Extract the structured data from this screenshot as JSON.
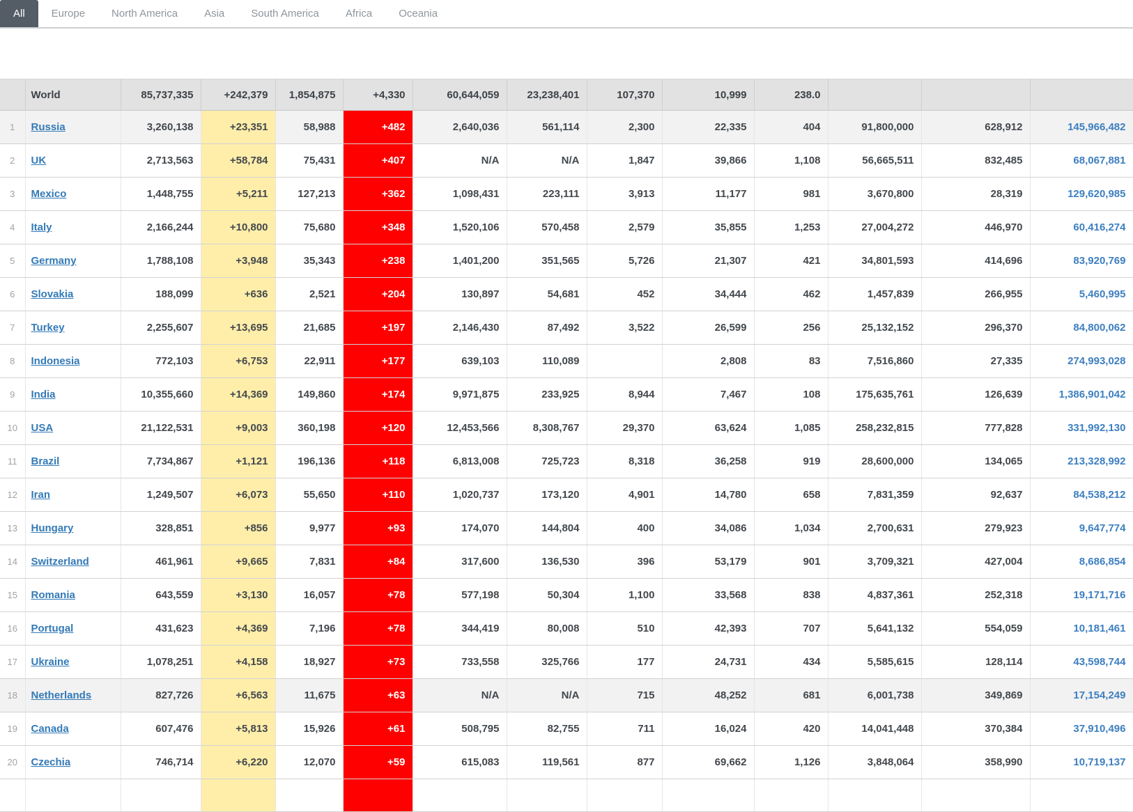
{
  "tabs": {
    "items": [
      {
        "label": "All",
        "active": true
      },
      {
        "label": "Europe",
        "active": false
      },
      {
        "label": "North America",
        "active": false
      },
      {
        "label": "Asia",
        "active": false
      },
      {
        "label": "South America",
        "active": false
      },
      {
        "label": "Africa",
        "active": false
      },
      {
        "label": "Oceania",
        "active": false
      }
    ]
  },
  "colors": {
    "active_tab_bg": "#545d66",
    "new_cases_bg": "#ffeeaa",
    "new_deaths_bg": "#ff0000",
    "link_blue": "#337ab7",
    "world_row_bg": "#e2e2e2",
    "shaded_row_bg": "#f2f2f2"
  },
  "table": {
    "column_keys": [
      "total_cases",
      "new_cases",
      "total_deaths",
      "new_deaths",
      "total_recovered",
      "active_cases",
      "serious_critical",
      "cases_per_1m",
      "deaths_per_1m",
      "total_tests",
      "tests_per_1m",
      "population"
    ],
    "world_row": {
      "label": "World",
      "values": {
        "total_cases": "85,737,335",
        "new_cases": "+242,379",
        "total_deaths": "1,854,875",
        "new_deaths": "+4,330",
        "total_recovered": "60,644,059",
        "active_cases": "23,238,401",
        "serious_critical": "107,370",
        "cases_per_1m": "10,999",
        "deaths_per_1m": "238.0",
        "total_tests": "",
        "tests_per_1m": "",
        "population": ""
      }
    },
    "rows": [
      {
        "rank": "1",
        "country": "Russia",
        "shaded": true,
        "values": {
          "total_cases": "3,260,138",
          "new_cases": "+23,351",
          "total_deaths": "58,988",
          "new_deaths": "+482",
          "total_recovered": "2,640,036",
          "active_cases": "561,114",
          "serious_critical": "2,300",
          "cases_per_1m": "22,335",
          "deaths_per_1m": "404",
          "total_tests": "91,800,000",
          "tests_per_1m": "628,912",
          "population": "145,966,482"
        }
      },
      {
        "rank": "2",
        "country": "UK",
        "shaded": false,
        "values": {
          "total_cases": "2,713,563",
          "new_cases": "+58,784",
          "total_deaths": "75,431",
          "new_deaths": "+407",
          "total_recovered": "N/A",
          "active_cases": "N/A",
          "serious_critical": "1,847",
          "cases_per_1m": "39,866",
          "deaths_per_1m": "1,108",
          "total_tests": "56,665,511",
          "tests_per_1m": "832,485",
          "population": "68,067,881"
        }
      },
      {
        "rank": "3",
        "country": "Mexico",
        "shaded": false,
        "values": {
          "total_cases": "1,448,755",
          "new_cases": "+5,211",
          "total_deaths": "127,213",
          "new_deaths": "+362",
          "total_recovered": "1,098,431",
          "active_cases": "223,111",
          "serious_critical": "3,913",
          "cases_per_1m": "11,177",
          "deaths_per_1m": "981",
          "total_tests": "3,670,800",
          "tests_per_1m": "28,319",
          "population": "129,620,985"
        }
      },
      {
        "rank": "4",
        "country": "Italy",
        "shaded": false,
        "values": {
          "total_cases": "2,166,244",
          "new_cases": "+10,800",
          "total_deaths": "75,680",
          "new_deaths": "+348",
          "total_recovered": "1,520,106",
          "active_cases": "570,458",
          "serious_critical": "2,579",
          "cases_per_1m": "35,855",
          "deaths_per_1m": "1,253",
          "total_tests": "27,004,272",
          "tests_per_1m": "446,970",
          "population": "60,416,274"
        }
      },
      {
        "rank": "5",
        "country": "Germany",
        "shaded": false,
        "values": {
          "total_cases": "1,788,108",
          "new_cases": "+3,948",
          "total_deaths": "35,343",
          "new_deaths": "+238",
          "total_recovered": "1,401,200",
          "active_cases": "351,565",
          "serious_critical": "5,726",
          "cases_per_1m": "21,307",
          "deaths_per_1m": "421",
          "total_tests": "34,801,593",
          "tests_per_1m": "414,696",
          "population": "83,920,769"
        }
      },
      {
        "rank": "6",
        "country": "Slovakia",
        "shaded": false,
        "values": {
          "total_cases": "188,099",
          "new_cases": "+636",
          "total_deaths": "2,521",
          "new_deaths": "+204",
          "total_recovered": "130,897",
          "active_cases": "54,681",
          "serious_critical": "452",
          "cases_per_1m": "34,444",
          "deaths_per_1m": "462",
          "total_tests": "1,457,839",
          "tests_per_1m": "266,955",
          "population": "5,460,995"
        }
      },
      {
        "rank": "7",
        "country": "Turkey",
        "shaded": false,
        "values": {
          "total_cases": "2,255,607",
          "new_cases": "+13,695",
          "total_deaths": "21,685",
          "new_deaths": "+197",
          "total_recovered": "2,146,430",
          "active_cases": "87,492",
          "serious_critical": "3,522",
          "cases_per_1m": "26,599",
          "deaths_per_1m": "256",
          "total_tests": "25,132,152",
          "tests_per_1m": "296,370",
          "population": "84,800,062"
        }
      },
      {
        "rank": "8",
        "country": "Indonesia",
        "shaded": false,
        "values": {
          "total_cases": "772,103",
          "new_cases": "+6,753",
          "total_deaths": "22,911",
          "new_deaths": "+177",
          "total_recovered": "639,103",
          "active_cases": "110,089",
          "serious_critical": "",
          "cases_per_1m": "2,808",
          "deaths_per_1m": "83",
          "total_tests": "7,516,860",
          "tests_per_1m": "27,335",
          "population": "274,993,028"
        }
      },
      {
        "rank": "9",
        "country": "India",
        "shaded": false,
        "values": {
          "total_cases": "10,355,660",
          "new_cases": "+14,369",
          "total_deaths": "149,860",
          "new_deaths": "+174",
          "total_recovered": "9,971,875",
          "active_cases": "233,925",
          "serious_critical": "8,944",
          "cases_per_1m": "7,467",
          "deaths_per_1m": "108",
          "total_tests": "175,635,761",
          "tests_per_1m": "126,639",
          "population": "1,386,901,042"
        }
      },
      {
        "rank": "10",
        "country": "USA",
        "shaded": false,
        "values": {
          "total_cases": "21,122,531",
          "new_cases": "+9,003",
          "total_deaths": "360,198",
          "new_deaths": "+120",
          "total_recovered": "12,453,566",
          "active_cases": "8,308,767",
          "serious_critical": "29,370",
          "cases_per_1m": "63,624",
          "deaths_per_1m": "1,085",
          "total_tests": "258,232,815",
          "tests_per_1m": "777,828",
          "population": "331,992,130"
        }
      },
      {
        "rank": "11",
        "country": "Brazil",
        "shaded": false,
        "values": {
          "total_cases": "7,734,867",
          "new_cases": "+1,121",
          "total_deaths": "196,136",
          "new_deaths": "+118",
          "total_recovered": "6,813,008",
          "active_cases": "725,723",
          "serious_critical": "8,318",
          "cases_per_1m": "36,258",
          "deaths_per_1m": "919",
          "total_tests": "28,600,000",
          "tests_per_1m": "134,065",
          "population": "213,328,992"
        }
      },
      {
        "rank": "12",
        "country": "Iran",
        "shaded": false,
        "values": {
          "total_cases": "1,249,507",
          "new_cases": "+6,073",
          "total_deaths": "55,650",
          "new_deaths": "+110",
          "total_recovered": "1,020,737",
          "active_cases": "173,120",
          "serious_critical": "4,901",
          "cases_per_1m": "14,780",
          "deaths_per_1m": "658",
          "total_tests": "7,831,359",
          "tests_per_1m": "92,637",
          "population": "84,538,212"
        }
      },
      {
        "rank": "13",
        "country": "Hungary",
        "shaded": false,
        "values": {
          "total_cases": "328,851",
          "new_cases": "+856",
          "total_deaths": "9,977",
          "new_deaths": "+93",
          "total_recovered": "174,070",
          "active_cases": "144,804",
          "serious_critical": "400",
          "cases_per_1m": "34,086",
          "deaths_per_1m": "1,034",
          "total_tests": "2,700,631",
          "tests_per_1m": "279,923",
          "population": "9,647,774"
        }
      },
      {
        "rank": "14",
        "country": "Switzerland",
        "shaded": false,
        "values": {
          "total_cases": "461,961",
          "new_cases": "+9,665",
          "total_deaths": "7,831",
          "new_deaths": "+84",
          "total_recovered": "317,600",
          "active_cases": "136,530",
          "serious_critical": "396",
          "cases_per_1m": "53,179",
          "deaths_per_1m": "901",
          "total_tests": "3,709,321",
          "tests_per_1m": "427,004",
          "population": "8,686,854"
        }
      },
      {
        "rank": "15",
        "country": "Romania",
        "shaded": false,
        "values": {
          "total_cases": "643,559",
          "new_cases": "+3,130",
          "total_deaths": "16,057",
          "new_deaths": "+78",
          "total_recovered": "577,198",
          "active_cases": "50,304",
          "serious_critical": "1,100",
          "cases_per_1m": "33,568",
          "deaths_per_1m": "838",
          "total_tests": "4,837,361",
          "tests_per_1m": "252,318",
          "population": "19,171,716"
        }
      },
      {
        "rank": "16",
        "country": "Portugal",
        "shaded": false,
        "values": {
          "total_cases": "431,623",
          "new_cases": "+4,369",
          "total_deaths": "7,196",
          "new_deaths": "+78",
          "total_recovered": "344,419",
          "active_cases": "80,008",
          "serious_critical": "510",
          "cases_per_1m": "42,393",
          "deaths_per_1m": "707",
          "total_tests": "5,641,132",
          "tests_per_1m": "554,059",
          "population": "10,181,461"
        }
      },
      {
        "rank": "17",
        "country": "Ukraine",
        "shaded": false,
        "values": {
          "total_cases": "1,078,251",
          "new_cases": "+4,158",
          "total_deaths": "18,927",
          "new_deaths": "+73",
          "total_recovered": "733,558",
          "active_cases": "325,766",
          "serious_critical": "177",
          "cases_per_1m": "24,731",
          "deaths_per_1m": "434",
          "total_tests": "5,585,615",
          "tests_per_1m": "128,114",
          "population": "43,598,744"
        }
      },
      {
        "rank": "18",
        "country": "Netherlands",
        "shaded": true,
        "values": {
          "total_cases": "827,726",
          "new_cases": "+6,563",
          "total_deaths": "11,675",
          "new_deaths": "+63",
          "total_recovered": "N/A",
          "active_cases": "N/A",
          "serious_critical": "715",
          "cases_per_1m": "48,252",
          "deaths_per_1m": "681",
          "total_tests": "6,001,738",
          "tests_per_1m": "349,869",
          "population": "17,154,249"
        }
      },
      {
        "rank": "19",
        "country": "Canada",
        "shaded": false,
        "values": {
          "total_cases": "607,476",
          "new_cases": "+5,813",
          "total_deaths": "15,926",
          "new_deaths": "+61",
          "total_recovered": "508,795",
          "active_cases": "82,755",
          "serious_critical": "711",
          "cases_per_1m": "16,024",
          "deaths_per_1m": "420",
          "total_tests": "14,041,448",
          "tests_per_1m": "370,384",
          "population": "37,910,496"
        }
      },
      {
        "rank": "20",
        "country": "Czechia",
        "shaded": false,
        "values": {
          "total_cases": "746,714",
          "new_cases": "+6,220",
          "total_deaths": "12,070",
          "new_deaths": "+59",
          "total_recovered": "615,083",
          "active_cases": "119,561",
          "serious_critical": "877",
          "cases_per_1m": "69,662",
          "deaths_per_1m": "1,126",
          "total_tests": "3,848,064",
          "tests_per_1m": "358,990",
          "population": "10,719,137"
        }
      }
    ]
  }
}
